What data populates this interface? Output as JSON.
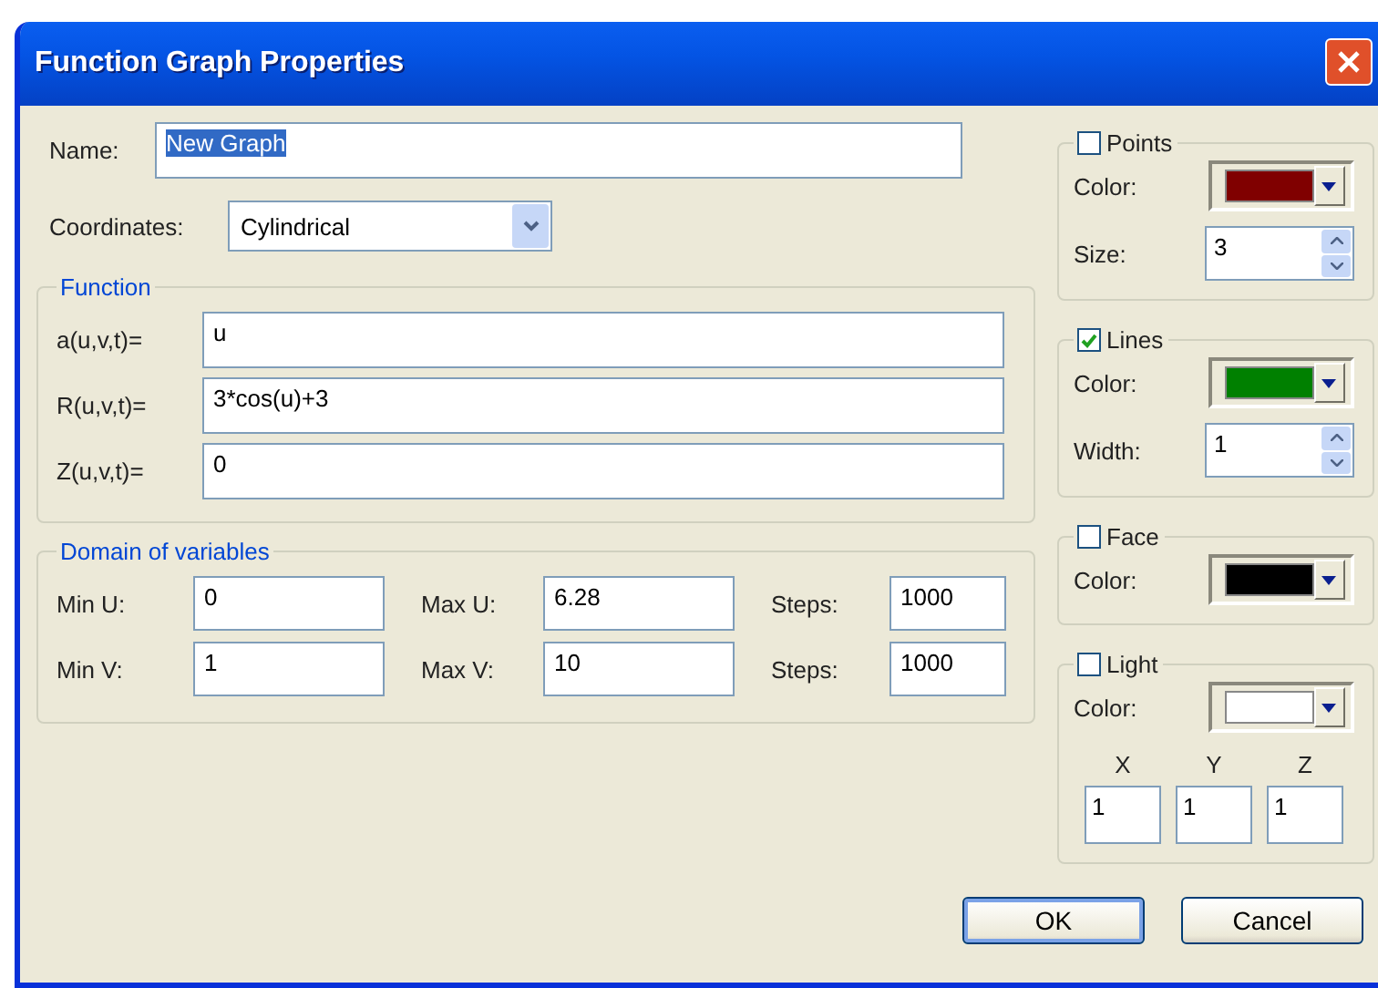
{
  "window": {
    "title": "Function Graph Properties"
  },
  "name": {
    "label": "Name:",
    "value": "New Graph",
    "selected": true
  },
  "coordinates": {
    "label": "Coordinates:",
    "value": "Cylindrical"
  },
  "function": {
    "title": "Function",
    "rows": [
      {
        "label": "a(u,v,t)=",
        "value": "u"
      },
      {
        "label": "R(u,v,t)=",
        "value": "3*cos(u)+3"
      },
      {
        "label": "Z(u,v,t)=",
        "value": "0"
      }
    ]
  },
  "domain": {
    "title": "Domain of variables",
    "rows": [
      [
        {
          "label": "Min U:",
          "value": "0"
        },
        {
          "label": "Max U:",
          "value": "6.28"
        },
        {
          "label": "Steps:",
          "value": "1000"
        }
      ],
      [
        {
          "label": "Min V:",
          "value": "1"
        },
        {
          "label": "Max V:",
          "value": "10"
        },
        {
          "label": "Steps:",
          "value": "1000"
        }
      ]
    ]
  },
  "groups": [
    {
      "kind": "spin",
      "label": "Points",
      "checked": false,
      "color_label": "Color:",
      "color": "#800000",
      "spin_label": "Size:",
      "spin_value": "3"
    },
    {
      "kind": "spin",
      "label": "Lines",
      "checked": true,
      "color_label": "Color:",
      "color": "#008000",
      "spin_label": "Width:",
      "spin_value": "1"
    },
    {
      "kind": "color",
      "label": "Face",
      "checked": false,
      "color_label": "Color:",
      "color": "#000000"
    },
    {
      "kind": "light",
      "label": "Light",
      "checked": false,
      "color_label": "Color:",
      "color": "#ffffff",
      "coords": [
        {
          "axis": "X",
          "value": "1"
        },
        {
          "axis": "Y",
          "value": "1"
        },
        {
          "axis": "Z",
          "value": "1"
        }
      ]
    }
  ],
  "buttons": [
    {
      "label": "OK",
      "default": true
    },
    {
      "label": "Cancel",
      "default": false
    }
  ]
}
